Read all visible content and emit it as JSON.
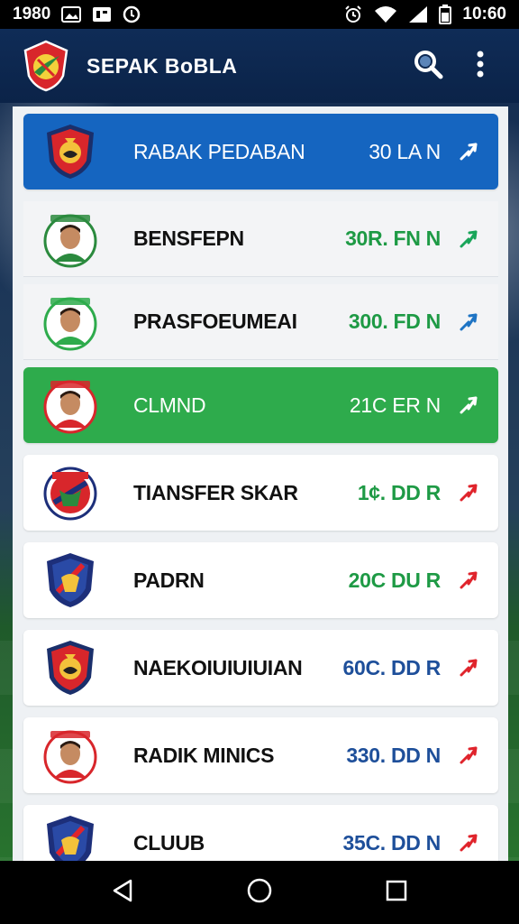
{
  "status_bar": {
    "left_text": "1980",
    "time": "10:60"
  },
  "app_bar": {
    "title": "SEPAK BoBLA",
    "logo_icon": "team-crest-icon",
    "search_icon": "search-icon",
    "menu_icon": "more-vert-icon"
  },
  "colors": {
    "app_bar": "#0b2348",
    "selected_blue": "#1565c0",
    "selected_green": "#2eab4c",
    "fee_green": "#1e9a45",
    "fee_blue": "#1e4f9a",
    "trend_up_green": "#19a55a",
    "trend_up_blue": "#1e74c4",
    "trend_up_red": "#e0242c"
  },
  "transfers": [
    {
      "name": "RABAK PEDABAN",
      "fee": "30 LA N",
      "fee_color": "#ffffff",
      "trend_color": "#ffffff",
      "style": "sel-blue",
      "crest": "crest-red-shield-icon"
    },
    {
      "name": "BENSFEPN",
      "fee": "30R. FN N",
      "fee_color": "#1e9a45",
      "trend_color": "#19a55a",
      "style": "flat",
      "crest": "player-portrait-icon"
    },
    {
      "name": "PRASFOEUMEAI",
      "fee": "300. FD N",
      "fee_color": "#1e9a45",
      "trend_color": "#1e74c4",
      "style": "flat",
      "crest": "player-portrait-icon"
    },
    {
      "name": "CLMND",
      "fee": "21C ER N",
      "fee_color": "#ffffff",
      "trend_color": "#ffffff",
      "style": "sel-green",
      "crest": "player-portrait-icon"
    },
    {
      "name": "TIANSFER SKAR",
      "fee": "1¢. DD R",
      "fee_color": "#1e9a45",
      "trend_color": "#e0242c",
      "style": "card",
      "crest": "crest-round-icon"
    },
    {
      "name": "PADRN",
      "fee": "20C DU R",
      "fee_color": "#1e9a45",
      "trend_color": "#e0242c",
      "style": "card",
      "crest": "crest-blue-shield-icon"
    },
    {
      "name": "NAEKOIUIUIUIAN",
      "fee": "60C. DD R",
      "fee_color": "#1e4f9a",
      "trend_color": "#e0242c",
      "style": "card",
      "crest": "crest-red-shield-icon"
    },
    {
      "name": "RADIK MINICS",
      "fee": "330. DD N",
      "fee_color": "#1e4f9a",
      "trend_color": "#e0242c",
      "style": "card",
      "crest": "player-portrait-icon"
    },
    {
      "name": "CLUUB",
      "fee": "35C. DD N",
      "fee_color": "#1e4f9a",
      "trend_color": "#e0242c",
      "style": "card",
      "crest": "crest-blue-shield-icon"
    }
  ],
  "nav_bar": {
    "back_icon": "back-triangle-icon",
    "home_icon": "home-circle-icon",
    "recents_icon": "recents-square-icon"
  }
}
